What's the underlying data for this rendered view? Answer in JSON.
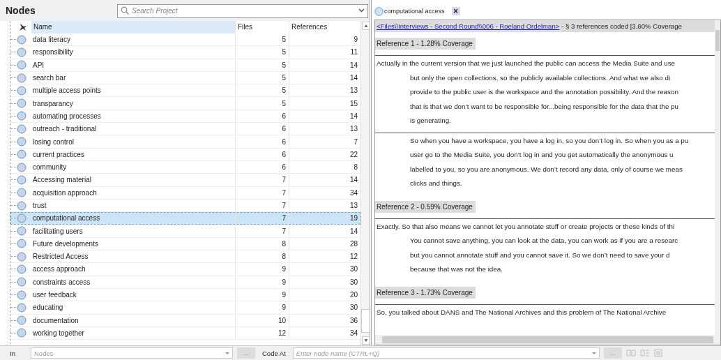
{
  "panel_title": "Nodes",
  "search": {
    "placeholder": "Search Project"
  },
  "table": {
    "columns": [
      "Name",
      "Files",
      "References"
    ],
    "rows": [
      {
        "name": "data literacy",
        "files": "5",
        "references": "9",
        "selected": false
      },
      {
        "name": "responsibility",
        "files": "5",
        "references": "11",
        "selected": false
      },
      {
        "name": "API",
        "files": "5",
        "references": "14",
        "selected": false
      },
      {
        "name": "search bar",
        "files": "5",
        "references": "14",
        "selected": false
      },
      {
        "name": "multiple access points",
        "files": "5",
        "references": "13",
        "selected": false
      },
      {
        "name": "transparancy",
        "files": "5",
        "references": "15",
        "selected": false
      },
      {
        "name": "automating processes",
        "files": "6",
        "references": "14",
        "selected": false
      },
      {
        "name": "outreach - traditional",
        "files": "6",
        "references": "13",
        "selected": false
      },
      {
        "name": "losing control",
        "files": "6",
        "references": "7",
        "selected": false
      },
      {
        "name": "current practices",
        "files": "6",
        "references": "22",
        "selected": false
      },
      {
        "name": "community",
        "files": "6",
        "references": "8",
        "selected": false
      },
      {
        "name": "Accessing material",
        "files": "7",
        "references": "14",
        "selected": false
      },
      {
        "name": "acquisition approach",
        "files": "7",
        "references": "34",
        "selected": false
      },
      {
        "name": "trust",
        "files": "7",
        "references": "13",
        "selected": false
      },
      {
        "name": "computational access",
        "files": "7",
        "references": "19",
        "selected": true
      },
      {
        "name": "facilitating users",
        "files": "7",
        "references": "14",
        "selected": false
      },
      {
        "name": "Future developments",
        "files": "8",
        "references": "28",
        "selected": false
      },
      {
        "name": "Restricted Access",
        "files": "8",
        "references": "12",
        "selected": false
      },
      {
        "name": "access approach",
        "files": "9",
        "references": "30",
        "selected": false
      },
      {
        "name": "constraints access",
        "files": "9",
        "references": "30",
        "selected": false
      },
      {
        "name": "user feedback",
        "files": "9",
        "references": "20",
        "selected": false
      },
      {
        "name": "educating",
        "files": "9",
        "references": "30",
        "selected": false
      },
      {
        "name": "documentation",
        "files": "10",
        "references": "36",
        "selected": false
      },
      {
        "name": "working together",
        "files": "12",
        "references": "34",
        "selected": false
      }
    ]
  },
  "detail_tab": {
    "label": "computational access",
    "close": "×"
  },
  "document": {
    "link": "<Files\\\\Interviews - Second Round\\\\006 - Roeland Ordelman>",
    "summary": "- § 3 references coded  [3.60% Coverage",
    "references": [
      {
        "title": "Reference 1 - 1.28% Coverage",
        "paragraphs": [
          [
            "Actually in the current version that we just launched the public can access the Media Suite and use",
            "but only the open collections, so the publicly available collections. And what we also di",
            "provide to the public user is the workspace and the annotation possibility. And the reason",
            "that is that we don’t want to be responsible for...being responsible for the data that the pu",
            "is generating."
          ],
          [
            "So when you have a workspace, you have a log in, so you don’t log in. So when you as a pu",
            "user go to the Media Suite, you don’t log in and you get automatically the anonymous u",
            "labelled to you, so you are anonymous. We don’t record any data, only of course we meas",
            "clicks and things."
          ]
        ]
      },
      {
        "title": "Reference 2 - 0.59% Coverage",
        "paragraphs": [
          [
            "Exactly. So that also means we cannot let you annotate stuff or create projects or these kinds of thi",
            "You cannot save anything, you can look at the data, you can work as if you are a researc",
            "but you cannot annotate stuff and you cannot save it. So we don’t need to save your d",
            "because that was not the idea."
          ]
        ]
      },
      {
        "title": "Reference 3 - 1.73% Coverage",
        "paragraphs": [
          [
            "So, you talked about DANS and The National Archives and this problem of The National Archive"
          ]
        ]
      }
    ]
  },
  "bottom_bar": {
    "in_label": "In",
    "in_value": "Nodes",
    "browse_1": "...",
    "code_at_label": "Code At",
    "node_placeholder": "Enter node name (CTRL+Q)",
    "browse_2": "..."
  }
}
